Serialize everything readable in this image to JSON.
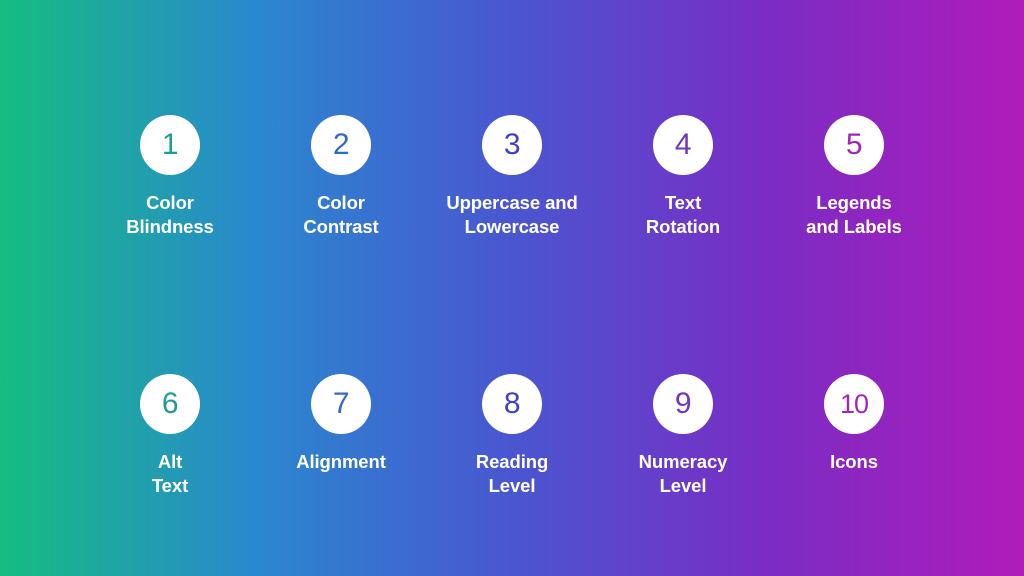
{
  "slide": {
    "background": {
      "type": "linear-gradient",
      "direction": "to right",
      "stops": [
        "#15bd80",
        "#2a88cf",
        "#4a56d0",
        "#7a2cc4",
        "#b01cba"
      ]
    },
    "badge_fill": "#ffffff"
  },
  "rows": [
    {
      "items": [
        {
          "number": "1",
          "label": "Color\nBlindness",
          "number_color": "#1f9d91"
        },
        {
          "number": "2",
          "label": "Color\nContrast",
          "number_color": "#3368c9"
        },
        {
          "number": "3",
          "label": "Uppercase and\nLowercase",
          "number_color": "#4440c4"
        },
        {
          "number": "4",
          "label": "Text\nRotation",
          "number_color": "#7036c0"
        },
        {
          "number": "5",
          "label": "Legends\nand Labels",
          "number_color": "#a126bb"
        }
      ]
    },
    {
      "items": [
        {
          "number": "6",
          "label": "Alt\nText",
          "number_color": "#1f9d91"
        },
        {
          "number": "7",
          "label": "Alignment",
          "number_color": "#3368c9"
        },
        {
          "number": "8",
          "label": "Reading\nLevel",
          "number_color": "#4440c4"
        },
        {
          "number": "9",
          "label": "Numeracy\nLevel",
          "number_color": "#7036c0"
        },
        {
          "number": "10",
          "label": "Icons",
          "number_color": "#a126bb"
        }
      ]
    }
  ]
}
